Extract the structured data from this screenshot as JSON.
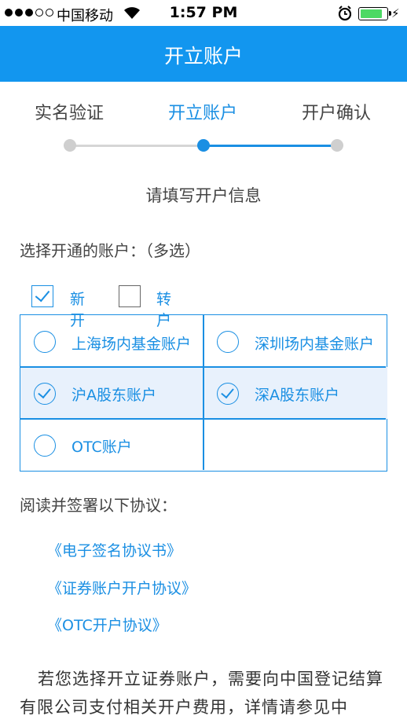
{
  "status_bar": {
    "carrier": "中国移动",
    "time": "1:57 PM",
    "signal_bars": 3,
    "battery_level": 0.75
  },
  "nav": {
    "title": "开立账户"
  },
  "steps": [
    {
      "label": "实名验证",
      "state": "done"
    },
    {
      "label": "开立账户",
      "state": "active"
    },
    {
      "label": "开户确认",
      "state": "pending"
    }
  ],
  "form": {
    "subtitle": "请填写开户信息",
    "select_title": "选择开通的账户：（多选）",
    "open_options": [
      {
        "label": "新开",
        "checked": true
      },
      {
        "label": "转户",
        "checked": false
      }
    ],
    "accounts": [
      {
        "label": "上海场内基金账户",
        "checked": false
      },
      {
        "label": "深圳场内基金账户",
        "checked": false
      },
      {
        "label": "沪A股东账户",
        "checked": true
      },
      {
        "label": "深A股东账户",
        "checked": true
      },
      {
        "label": "OTC账户",
        "checked": false
      }
    ]
  },
  "agreements": {
    "title": "阅读并签署以下协议：",
    "links": [
      "《电子签名协议书》",
      "《证券账户开户协议》",
      "《OTC开户协议》"
    ]
  },
  "note": "若您选择开立证券账户，需要向中国登记结算有限公司支付相关开户费用，详情请参见中",
  "colors": {
    "primary": "#1296ef",
    "accent": "#1a8fe3",
    "selected_bg": "#e8f1fc"
  },
  "icons": [
    "wifi-icon",
    "alarm-icon",
    "battery-icon",
    "check-icon",
    "radio-icon"
  ]
}
